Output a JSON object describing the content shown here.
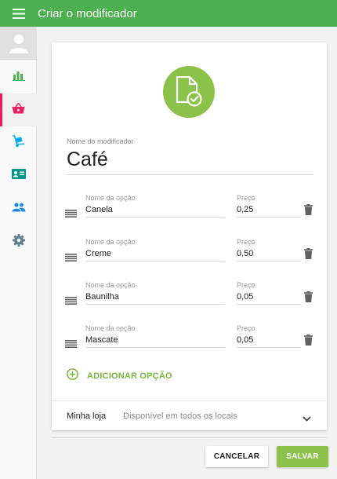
{
  "app": {
    "title": "Criar o modificador"
  },
  "sidebar": {
    "items": [
      {
        "icon": "bar-chart-icon",
        "color": "#4caf50"
      },
      {
        "icon": "basket-icon",
        "color": "#e91e63",
        "active": true
      },
      {
        "icon": "hand-truck-icon",
        "color": "#03a9f4"
      },
      {
        "icon": "id-card-icon",
        "color": "#009688"
      },
      {
        "icon": "people-icon",
        "color": "#1e88e5"
      },
      {
        "icon": "gear-icon",
        "color": "#607d8b"
      }
    ]
  },
  "form": {
    "name_label": "Nome do modificador",
    "name_value": "Café",
    "options": [
      {
        "label": "Nome da opção",
        "value": "Canela",
        "price_label": "Preço",
        "price": "0,25"
      },
      {
        "label": "Nome da opção",
        "value": "Creme",
        "price_label": "Preço",
        "price": "0,50"
      },
      {
        "label": "Nome da opção",
        "value": "Baunilha",
        "price_label": "Preço",
        "price": "0,05"
      },
      {
        "label": "Nome da opção",
        "value": "Mascate",
        "price_label": "Preço",
        "price": "0,05"
      }
    ],
    "add_option_label": "ADICIONAR OPÇÃO",
    "store_name": "Minha loja",
    "store_availability": "Disponível em todos os locais"
  },
  "actions": {
    "cancel_label": "CANCELAR",
    "save_label": "SALVAR"
  },
  "colors": {
    "appbar": "#4caf50",
    "accent": "#8bc34a",
    "active": "#e91e63"
  }
}
